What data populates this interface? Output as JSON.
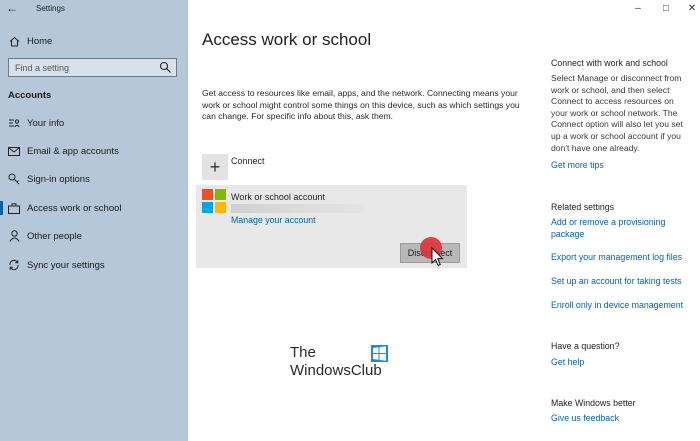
{
  "window": {
    "app_title": "Settings",
    "controls": [
      "minimize",
      "maximize",
      "close"
    ]
  },
  "sidebar": {
    "back_icon": "back-arrow-icon",
    "home": {
      "label": "Home",
      "icon": "home-icon"
    },
    "search": {
      "placeholder": "Find a setting",
      "icon": "search-icon"
    },
    "section_label": "Accounts",
    "items": [
      {
        "label": "Your info",
        "icon": "person-card-icon"
      },
      {
        "label": "Email & app accounts",
        "icon": "mail-icon"
      },
      {
        "label": "Sign-in options",
        "icon": "key-icon"
      },
      {
        "label": "Access work or school",
        "icon": "briefcase-icon",
        "active": true
      },
      {
        "label": "Other people",
        "icon": "person-icon"
      },
      {
        "label": "Sync your settings",
        "icon": "sync-icon"
      }
    ]
  },
  "main": {
    "title": "Access work or school",
    "description": "Get access to resources like email, apps, and the network. Connecting means your work or school might control some things on this device, such as which settings you can change. For specific info about this, ask them.",
    "connect_label": "Connect",
    "account": {
      "name": "Work or school account",
      "manage_link": "Manage your account",
      "disconnect_label": "Disconnect"
    }
  },
  "watermark": {
    "line1": "The",
    "line2": "WindowsClub"
  },
  "right": {
    "connect_heading": "Connect with work and school",
    "connect_text": "Select Manage or disconnect from work or school, and then select Connect to access resources on your work or school network. The Connect option will also let you set up a work or school account if you don't have one already.",
    "more_tips": "Get more tips",
    "related_heading": "Related settings",
    "related_links": [
      "Add or remove a provisioning package",
      "Export your management log files",
      "Set up an account for taking tests",
      "Enroll only in device management"
    ],
    "question_heading": "Have a question?",
    "get_help": "Get help",
    "better_heading": "Make Windows better",
    "feedback": "Give us feedback"
  },
  "colors": {
    "accent": "#0063b1",
    "sidebar_bg": "#b5c7d8",
    "card_bg": "#e8e8e8",
    "click_marker": "#e0323a"
  }
}
